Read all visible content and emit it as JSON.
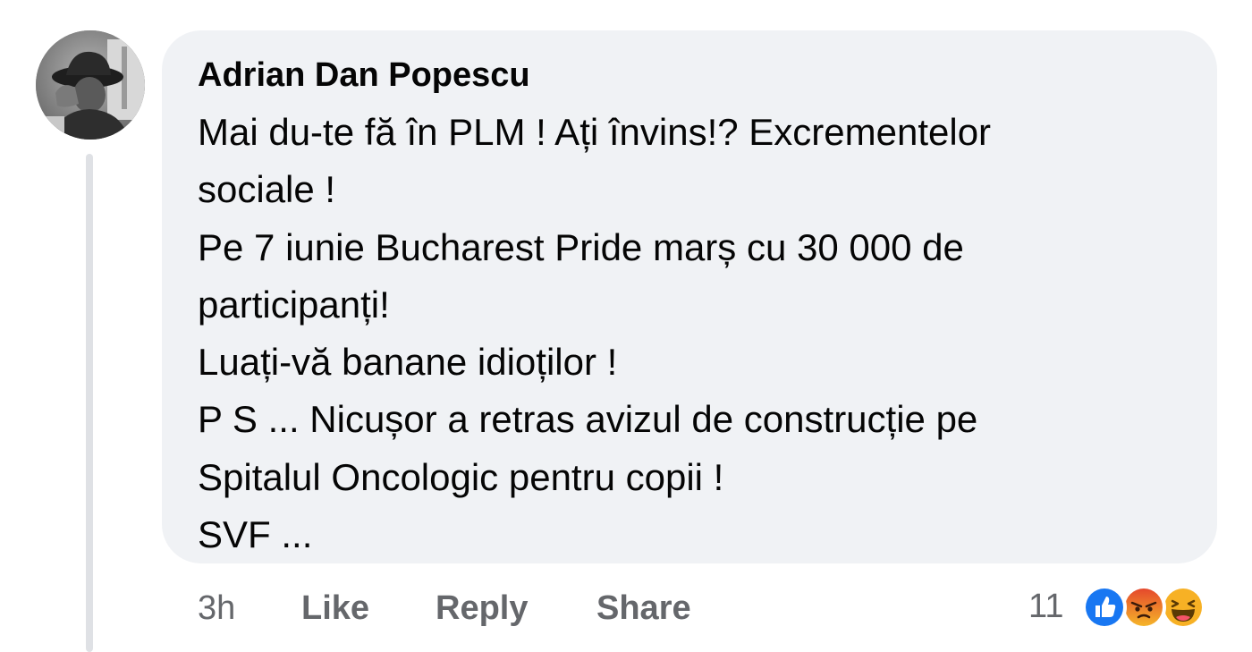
{
  "comment": {
    "author": "Adrian Dan Popescu",
    "lines": [
      "Mai du-te fă în PLM ! Ați învins!? Excrementelor",
      "sociale !",
      "Pe 7 iunie  Bucharest Pride marș cu 30 000 de",
      "participanți!",
      "Luați-vă banane idioților !",
      "P S ... Nicușor a retras avizul de construcție pe",
      "Spitalul Oncologic pentru copii !",
      "SVF ..."
    ]
  },
  "actions": {
    "timestamp": "3h",
    "like_label": "Like",
    "reply_label": "Reply",
    "share_label": "Share"
  },
  "reactions": {
    "count": "11",
    "types": [
      "like-icon",
      "angry-icon",
      "haha-icon"
    ],
    "colors": {
      "like": "#1877f2",
      "angry": "#e9710f",
      "haha": "#f7b125"
    }
  },
  "colors": {
    "bubble_bg": "#f0f2f5",
    "text": "#050505",
    "secondary_text": "#65676b",
    "thread_line": "#dfe1e5"
  }
}
